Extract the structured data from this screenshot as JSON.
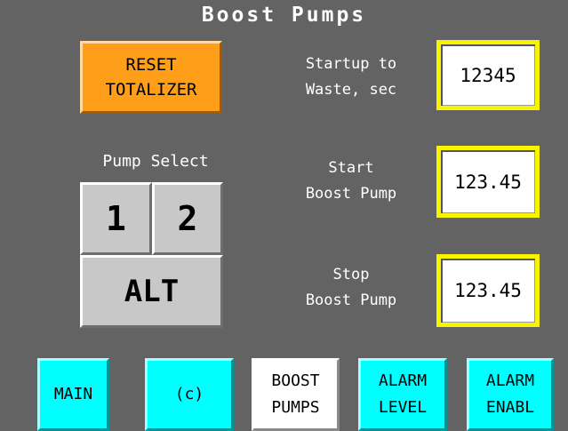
{
  "title": "Boost Pumps",
  "reset_button": {
    "line1": "RESET",
    "line2": "TOTALIZER"
  },
  "pump_select": {
    "label": "Pump Select",
    "button_1": "1",
    "button_2": "2",
    "button_alt": "ALT"
  },
  "fields": {
    "startup_label_1": "Startup to",
    "startup_label_2": "Waste, sec",
    "startup_value": "12345",
    "start_label_1": "Start",
    "start_label_2": "Boost Pump",
    "start_value": "123.45",
    "stop_label_1": "Stop",
    "stop_label_2": "Boost Pump",
    "stop_value": "123.45"
  },
  "nav": {
    "main": "MAIN",
    "c": "(c)",
    "boost_1": "BOOST",
    "boost_2": "PUMPS",
    "alarm_level_1": "ALARM",
    "alarm_level_2": "LEVEL",
    "alarm_enabl_1": "ALARM",
    "alarm_enabl_2": "ENABL"
  },
  "colors": {
    "background": "#636363",
    "reset_button": "#ff9e18",
    "field_border": "#f8f400",
    "pump_button": "#c8c8c8",
    "nav_active": "#ffffff",
    "nav_inactive": "#00ffff"
  }
}
